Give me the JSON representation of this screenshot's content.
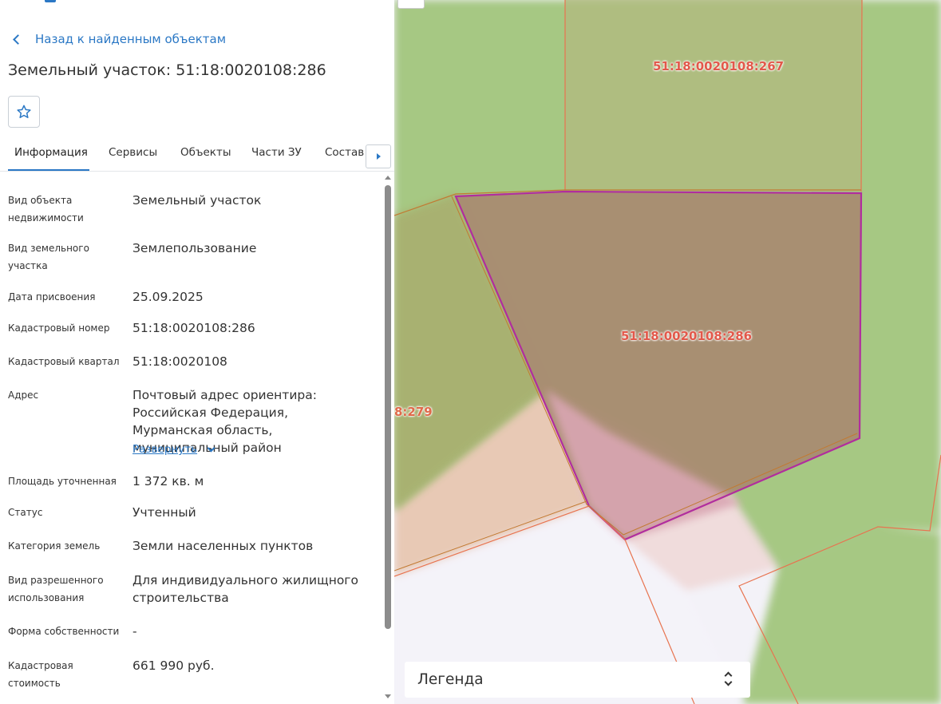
{
  "panel": {
    "back_label": "Назад к найденным объектам",
    "title": "Земельный участок: 51:18:0020108:286",
    "favorite_icon": "star-icon",
    "tabs": [
      {
        "label": "Информация",
        "active": true
      },
      {
        "label": "Сервисы",
        "active": false
      },
      {
        "label": "Объекты",
        "active": false
      },
      {
        "label": "Части ЗУ",
        "active": false
      },
      {
        "label": "Состав",
        "active": false
      }
    ],
    "tab_scroll_icon": "caret-right-icon",
    "fields": [
      {
        "label": "Вид объекта недвижимости",
        "value": "Земельный участок"
      },
      {
        "label": "Вид земельного участка",
        "value": "Землепользование"
      },
      {
        "label": "Дата присвоения",
        "value": "25.09.2025"
      },
      {
        "label": "Кадастровый номер",
        "value": "51:18:0020108:286"
      },
      {
        "label": "Кадастровый квартал",
        "value": "51:18:0020108"
      },
      {
        "label": "Адрес",
        "value": "Почтовый адрес ориентира: Российская Федерация, Мурманская область, муниципальный район",
        "expand_label": "Развернуть"
      },
      {
        "label": "Площадь уточненная",
        "value": "1 372 кв. м"
      },
      {
        "label": "Статус",
        "value": "Учтенный"
      },
      {
        "label": "Категория земель",
        "value": "Земли населенных пунктов"
      },
      {
        "label": "Вид разрешенного использования",
        "value": "Для индивидуального жилищного строительства"
      },
      {
        "label": "Форма собственности",
        "value": "-"
      },
      {
        "label": "Кадастровая стоимость",
        "value": "661 990 руб."
      }
    ]
  },
  "map": {
    "parcel_labels": {
      "top": "51:18:0020108:267",
      "selected": "51:18:0020108:286",
      "left_partial": "8:279"
    },
    "legend_label": "Легенда",
    "legend_icon": "chevron-up-down-icon",
    "colors": {
      "green_area": "#a6c883",
      "selected_fill": "#a88c72",
      "selected_stroke": "#b12d9e",
      "parcel_border": "#e8734f",
      "label_text": "#e2584a",
      "link": "#2b78c5"
    }
  }
}
